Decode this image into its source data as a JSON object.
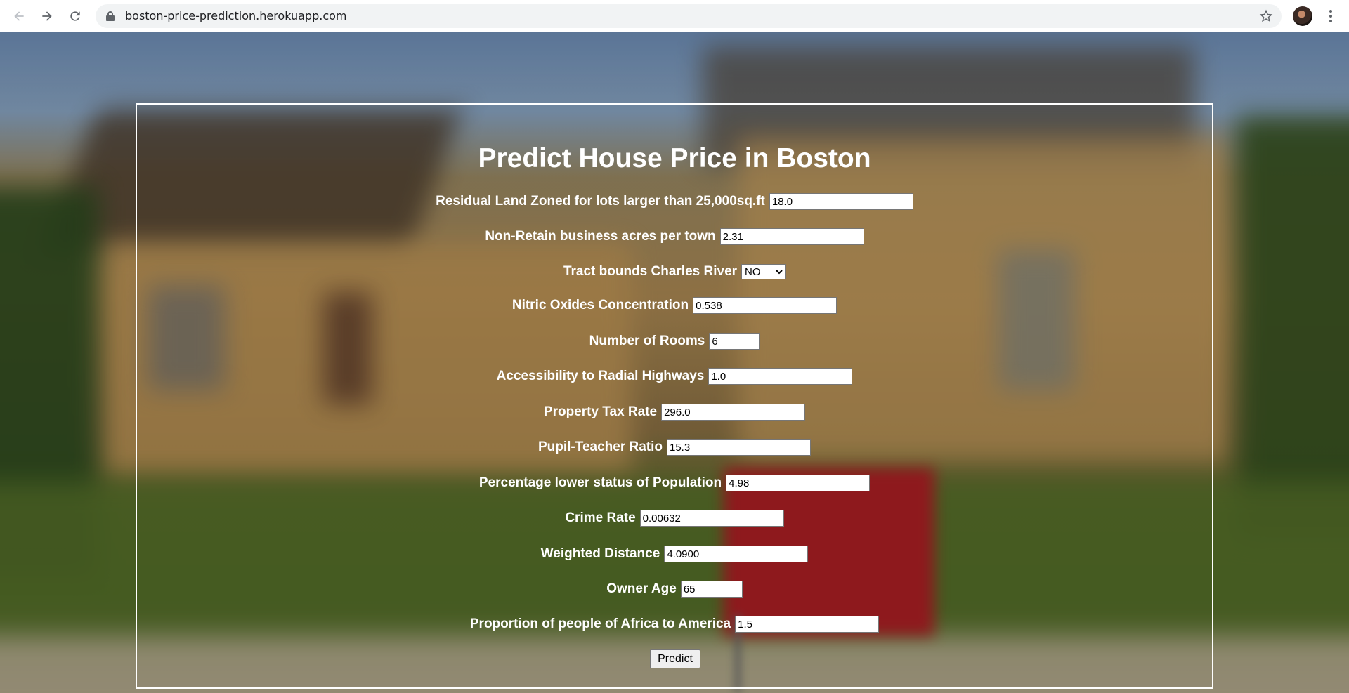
{
  "browser": {
    "url": "boston-price-prediction.herokuapp.com"
  },
  "form": {
    "title": "Predict House Price in Boston",
    "fields": [
      {
        "label": "Residual Land Zoned for lots larger than 25,000sq.ft",
        "value": "18.0"
      },
      {
        "label": "Non-Retain business acres per town",
        "value": "2.31"
      },
      {
        "label": "Tract bounds Charles River",
        "value": "NO"
      },
      {
        "label": "Nitric Oxides Concentration",
        "value": "0.538"
      },
      {
        "label": "Number of Rooms",
        "value": "6"
      },
      {
        "label": "Accessibility to Radial Highways",
        "value": "1.0"
      },
      {
        "label": "Property Tax Rate",
        "value": "296.0"
      },
      {
        "label": "Pupil-Teacher Ratio",
        "value": "15.3"
      },
      {
        "label": "Percentage lower status of Population",
        "value": "4.98"
      },
      {
        "label": "Crime Rate",
        "value": "0.00632"
      },
      {
        "label": "Weighted Distance",
        "value": "4.0900"
      },
      {
        "label": "Owner Age",
        "value": "65"
      },
      {
        "label": "Proportion of people of Africa to America",
        "value": "1.5"
      }
    ],
    "predict_label": "Predict"
  }
}
